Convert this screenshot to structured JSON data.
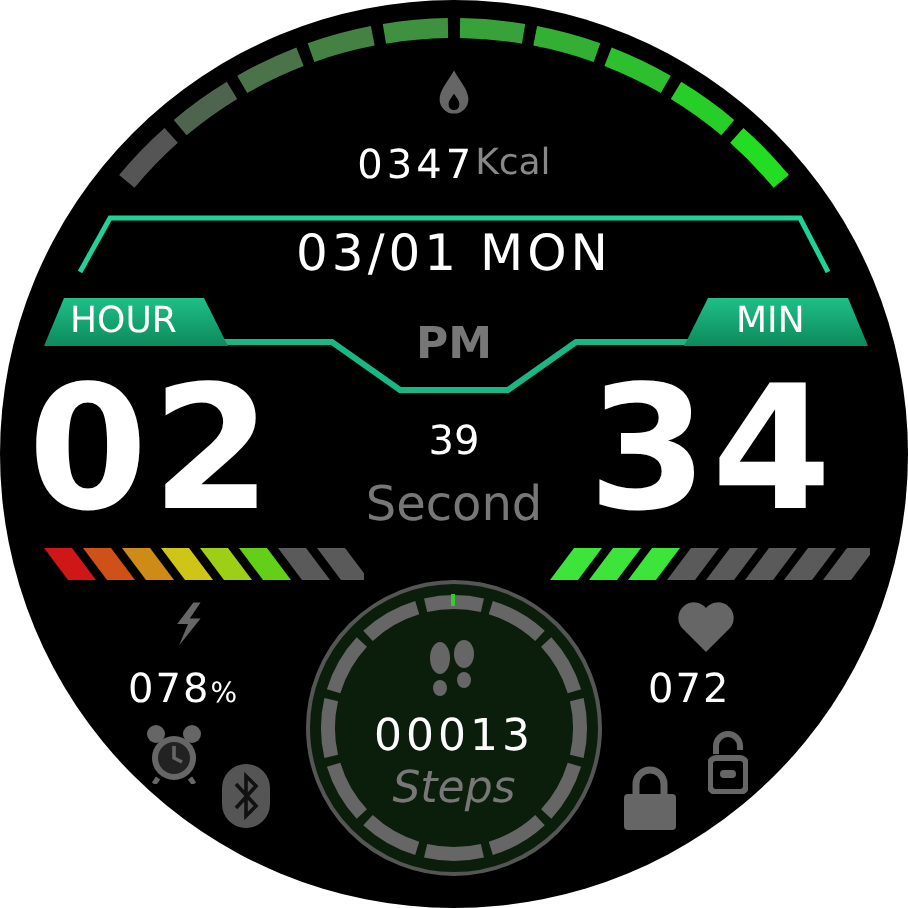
{
  "calories": {
    "value": "0347",
    "unit": "Kcal"
  },
  "date": "03/01 MON",
  "hour_label": "HOUR",
  "minute_label": "MIN",
  "ampm": "PM",
  "hour": "02",
  "minute": "34",
  "seconds": "39",
  "seconds_label": "Second",
  "battery": {
    "level": 0.78,
    "reading": "078",
    "unit": "%"
  },
  "heart_rate": {
    "level": 0.35,
    "reading": "072"
  },
  "steps": {
    "value": "00013",
    "label": "Steps"
  }
}
